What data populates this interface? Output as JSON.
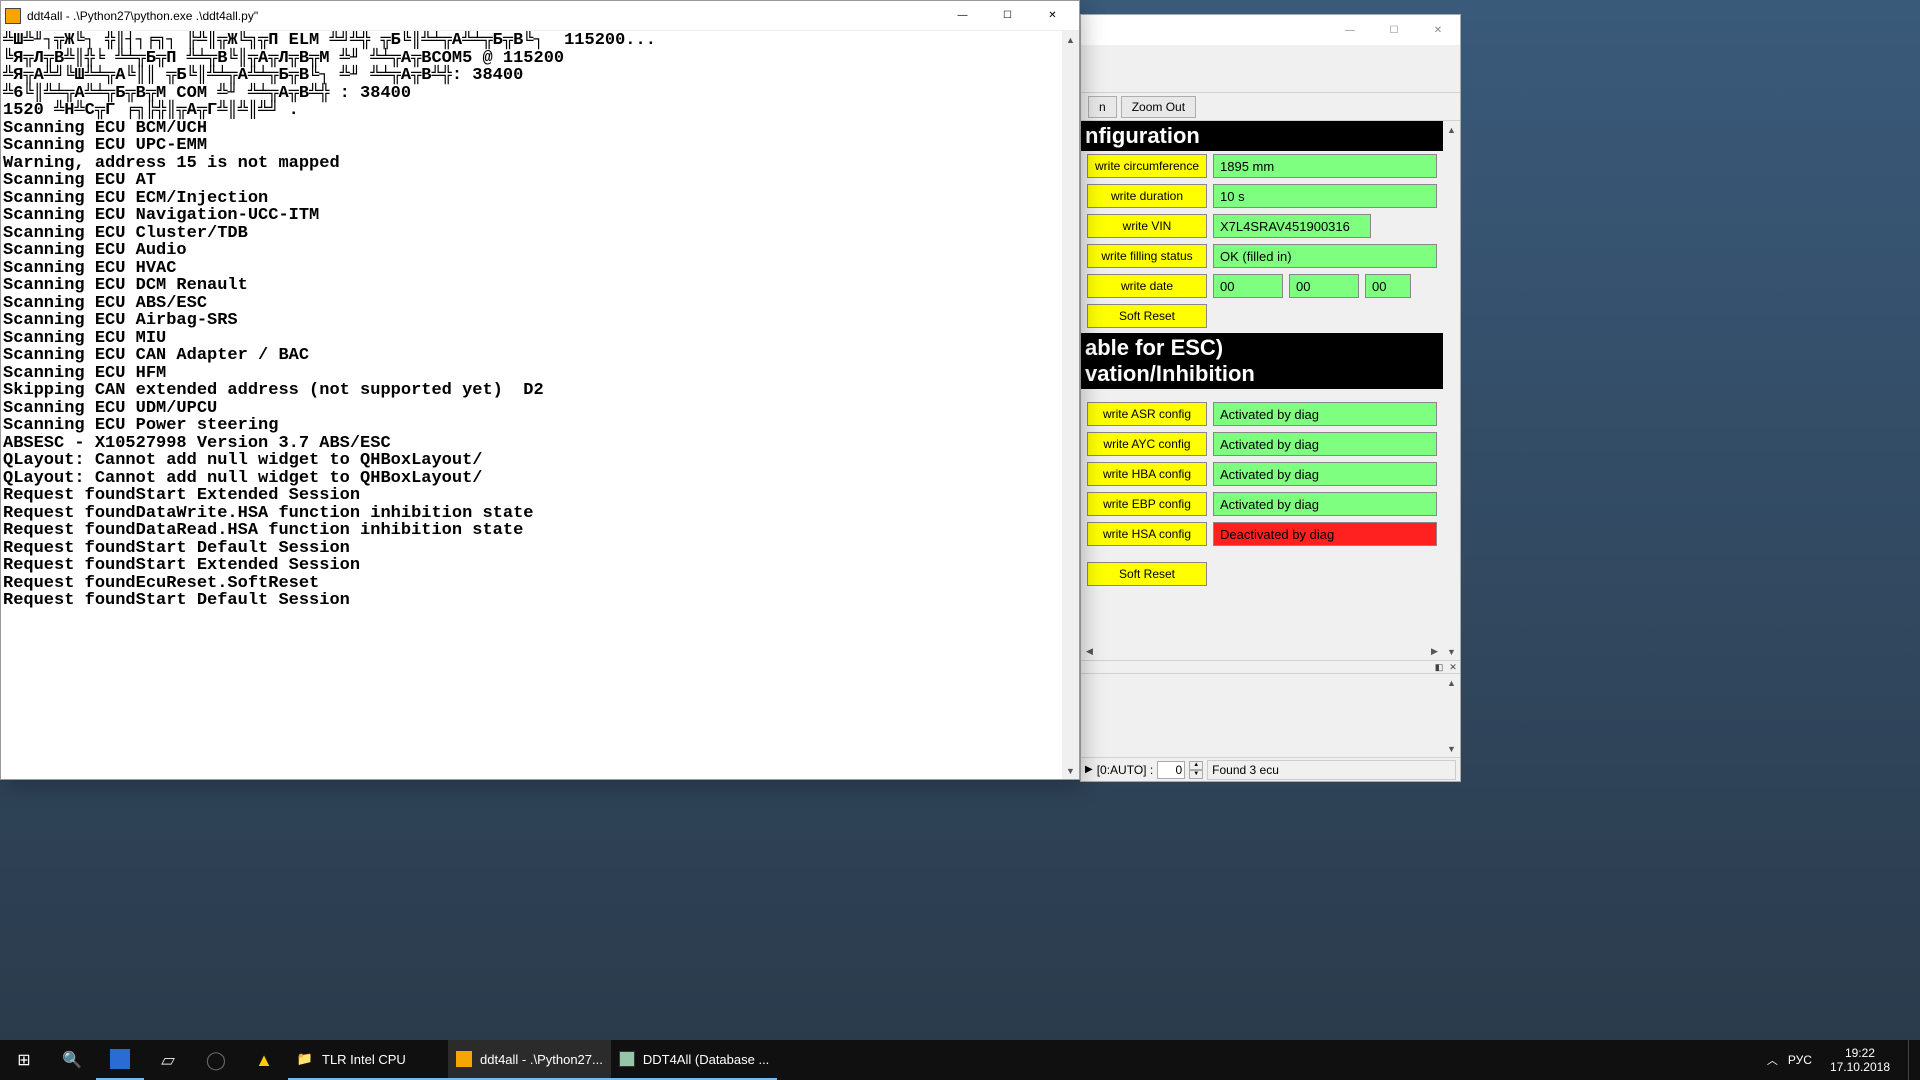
{
  "console": {
    "title": "ddt4all - .\\Python27\\python.exe  .\\ddt4all.py\"",
    "lines": "╩Ш╩╜┐╦Ж╚┐ ╬║┤┐╒╗┐ ╠╩║╦Ж╚╗╦П ELM ╩╝╩╬ ╦Б╚║╩╧╦А╩╧╦Б╦В╚┐  115200...\n╚Я╦Л╦В╩║╬╘ ╩╧╦Б╦П ╩╧╦В╚║╦А╦Л╦В╦М ╩╜ ╩╧╦А╦ВCOM5 @ 115200\n╩Я╦А╩╝╚Ш╩╧╦А╚║║ ╦Б╚║╩╧╦А╩╧╦Б╦В╚┐ ╩╜ ╩╧╦А╦В╩╬: 38400\n╩6╚║╩╧╦А╩╧╦Б╦В╦М COM ╩╜ ╩╧╦А╦В╩╬ : 38400\n1520 ╩Н╩C╦Г ╒╗╠╬║╦А╦Г╩║╩║╩╝ .\nScanning ECU BCM/UCH\nScanning ECU UPC-EMM\nWarning, address 15 is not mapped\nScanning ECU AT\nScanning ECU ECM/Injection\nScanning ECU Navigation-UCC-ITM\nScanning ECU Cluster/TDB\nScanning ECU Audio\nScanning ECU HVAC\nScanning ECU DCM Renault\nScanning ECU ABS/ESC\nScanning ECU Airbag-SRS\nScanning ECU MIU\nScanning ECU CAN Adapter / BAC\nScanning ECU HFM\nSkipping CAN extended address (not supported yet)  D2\nScanning ECU UDM/UPCU\nScanning ECU Power steering\nABSESC - X10527998 Version 3.7 ABS/ESC\nQLayout: Cannot add null widget to QHBoxLayout/\nQLayout: Cannot add null widget to QHBoxLayout/\nRequest foundStart Extended Session\nRequest foundDataWrite.HSA function inhibition state\nRequest foundDataRead.HSA function inhibition state\nRequest foundStart Default Session\nRequest foundStart Extended Session\nRequest foundEcuReset.SoftReset\nRequest foundStart Default Session"
  },
  "ddt": {
    "toolbar2": {
      "btn_n": "n",
      "zoom_out": "Zoom Out"
    },
    "section1_title": "nfiguration",
    "section2_title_a": "able for ESC)",
    "section2_title_b": "vation/Inhibition",
    "rows1": [
      {
        "btn": "write circumference",
        "val": "1895 mm"
      },
      {
        "btn": "write duration",
        "val": "10 s"
      },
      {
        "btn": "write VIN",
        "val": "X7L4SRAV451900316"
      },
      {
        "btn": "write filling status",
        "val": "OK (filled in)"
      }
    ],
    "rowDate": {
      "btn": "write date",
      "v1": "00",
      "v2": "00",
      "v3": "00"
    },
    "soft_reset": "Soft Reset",
    "rows2": [
      {
        "btn": "write ASR config",
        "val": "Activated by diag",
        "state": "on"
      },
      {
        "btn": "write AYC config",
        "val": "Activated by diag",
        "state": "on"
      },
      {
        "btn": "write HBA config",
        "val": "Activated by diag",
        "state": "on"
      },
      {
        "btn": "write EBP config",
        "val": "Activated by diag",
        "state": "on"
      },
      {
        "btn": "write HSA config",
        "val": "Deactivated by diag",
        "state": "off"
      }
    ],
    "status": {
      "auto_label": "[0:AUTO] :",
      "auto_val": "0",
      "found": "Found 3 ecu"
    }
  },
  "taskbar": {
    "items": [
      {
        "name": "start",
        "icon": "⊞"
      },
      {
        "name": "search",
        "icon": "⌕"
      },
      {
        "name": "save",
        "icon": "💾"
      },
      {
        "name": "explorer",
        "icon": "📄"
      },
      {
        "name": "circle",
        "icon": "◯"
      },
      {
        "name": "warn",
        "icon": "⚠"
      }
    ],
    "apps": [
      {
        "label": "TLR Intel CPU",
        "active": false
      },
      {
        "label": "ddt4all - .\\Python27...",
        "active": true
      },
      {
        "label": "DDT4All (Database ...",
        "active": true
      }
    ],
    "lang": "РУС",
    "time": "19:22",
    "date": "17.10.2018"
  }
}
